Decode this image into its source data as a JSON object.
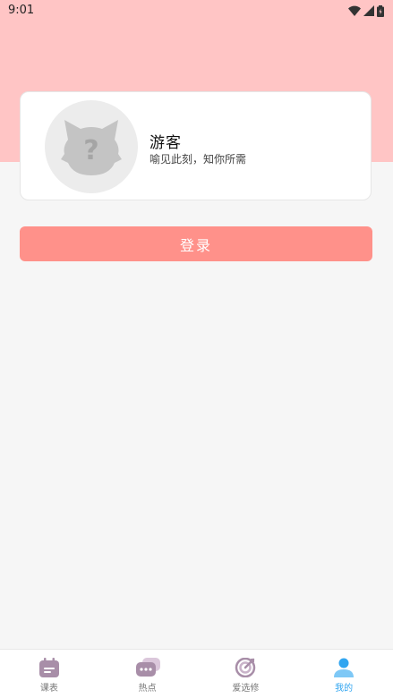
{
  "status_bar": {
    "time": "9:01",
    "icons": [
      "wifi-icon",
      "signal-icon",
      "battery-icon"
    ]
  },
  "profile": {
    "name": "游客",
    "tagline": "喻见此刻，知你所需",
    "avatar_icon": "unknown-user-cat-icon"
  },
  "login": {
    "label": "登录"
  },
  "bottom_nav": {
    "items": [
      {
        "label": "课表",
        "icon": "calendar-icon",
        "active": false
      },
      {
        "label": "热点",
        "icon": "chat-bubbles-icon",
        "active": false
      },
      {
        "label": "爱选修",
        "icon": "target-icon",
        "active": false
      },
      {
        "label": "我的",
        "icon": "person-icon",
        "active": true
      }
    ]
  },
  "colors": {
    "header_band": "#ffc5c5",
    "login_button": "#ff918a",
    "active_tab": "#31a5f0",
    "background": "#f6f6f6"
  }
}
